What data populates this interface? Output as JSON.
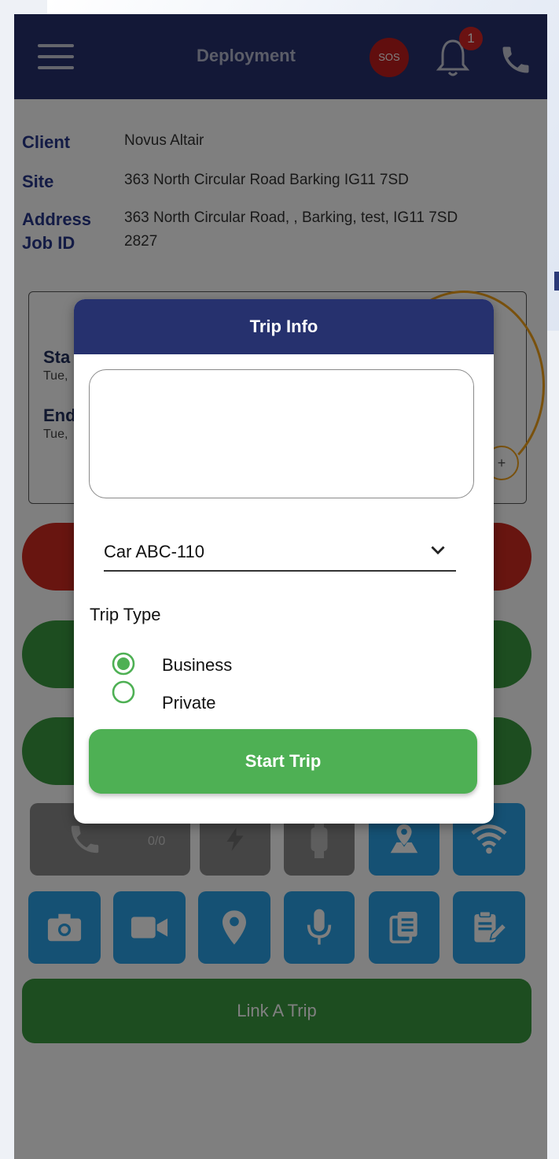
{
  "appbar": {
    "title": "Deployment",
    "sos_label": "SOS",
    "notification_count": "1"
  },
  "job": {
    "client_label": "Client",
    "client_value": "Novus Altair",
    "site_label": "Site",
    "site_value": "363 North Circular Road Barking IG11 7SD",
    "address_label": "Address",
    "address_value": "363 North Circular Road, , Barking, test, IG11 7SD",
    "jobid_label": "Job ID",
    "jobid_value": "2827"
  },
  "card": {
    "start_label": "Sta",
    "start_sub": "Tue,",
    "end_label": "End",
    "end_sub": "Tue,",
    "plus": "+"
  },
  "tiles": {
    "counter": "0/0"
  },
  "link_trip_label": "Link A Trip",
  "modal": {
    "title": "Trip Info",
    "notes_value": "",
    "vehicle_selected": "Car ABC-110",
    "trip_type_label": "Trip Type",
    "options": [
      {
        "label": "Business",
        "selected": true
      },
      {
        "label": "Private",
        "selected": false
      }
    ],
    "start_button": "Start Trip"
  },
  "colors": {
    "appbar": "#26316e",
    "accent_green": "#4eb054",
    "danger_red": "#d02a20",
    "tile_blue": "#2ba3e8"
  }
}
